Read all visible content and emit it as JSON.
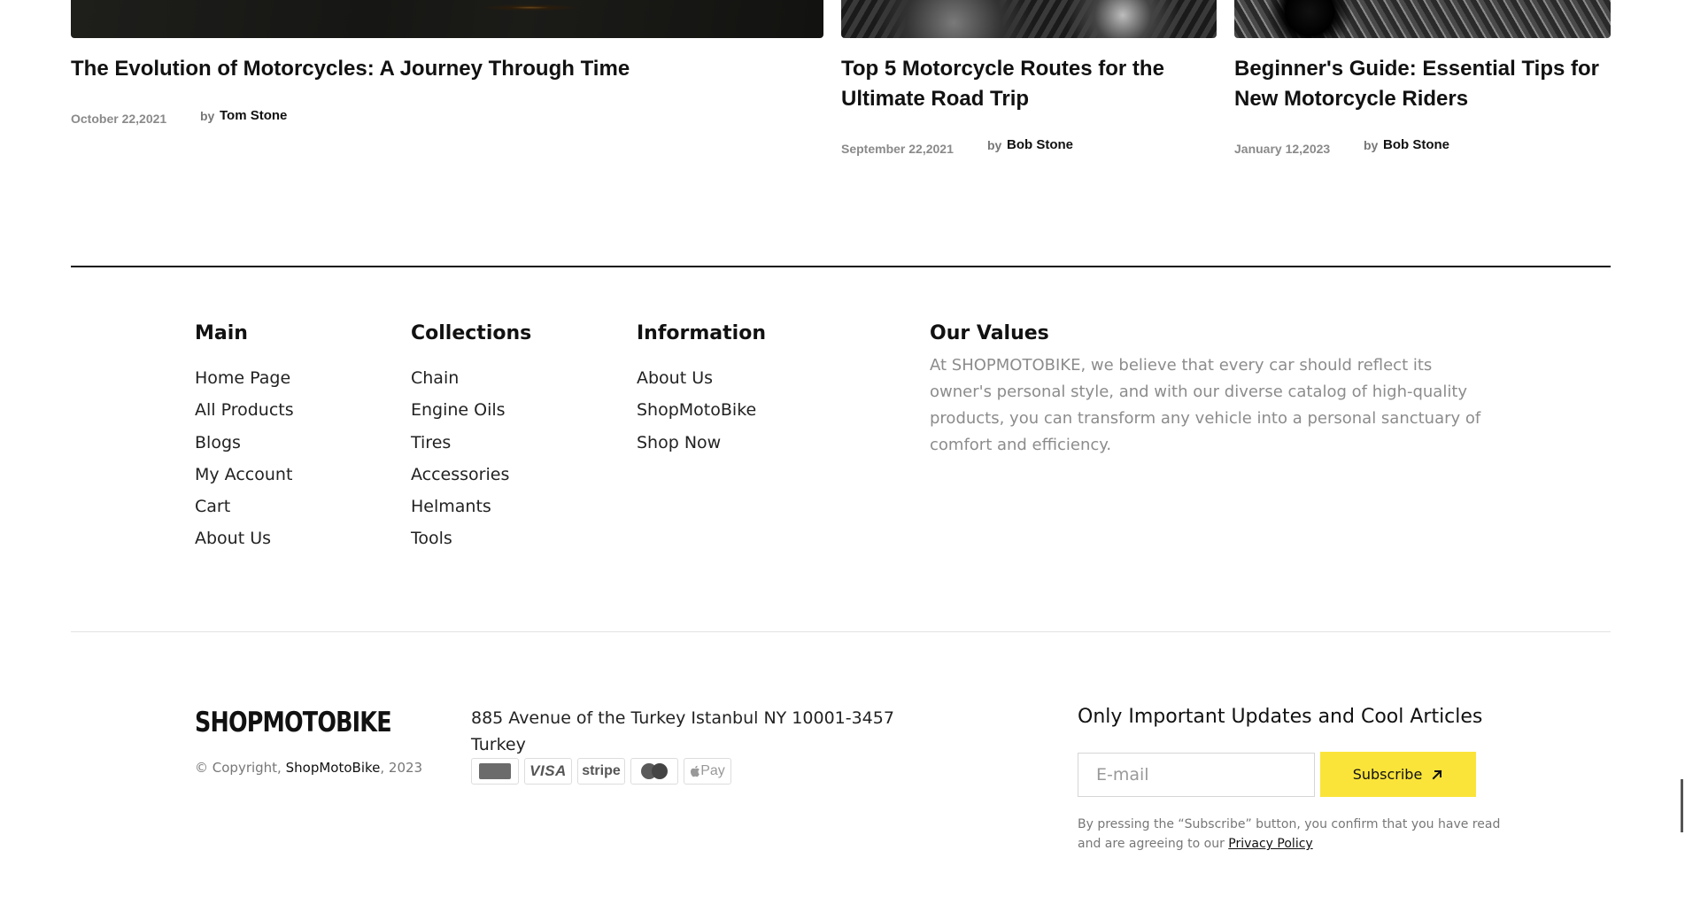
{
  "blog": {
    "posts": [
      {
        "title": "The Evolution of Motorcycles: A Journey Through Time",
        "date": "October 22,2021",
        "by": "by",
        "author": "Tom Stone"
      },
      {
        "title": "Top 5 Motorcycle Routes for the Ultimate Road Trip",
        "date": "September 22,2021",
        "by": "by",
        "author": "Bob Stone"
      },
      {
        "title": "Beginner's Guide: Essential Tips for New Motorcycle Riders",
        "date": "January 12,2023",
        "by": "by",
        "author": "Bob Stone"
      }
    ]
  },
  "footer": {
    "main": {
      "title": "Main",
      "links": [
        "Home Page",
        "All Products",
        "Blogs",
        "My Account",
        "Cart",
        "About Us"
      ]
    },
    "collections": {
      "title": "Collections",
      "links": [
        "Chain",
        "Engine Oils",
        "Tires",
        "Accessories",
        "Helmants",
        "Tools"
      ]
    },
    "information": {
      "title": "Information",
      "links": [
        "About Us",
        "ShopMotoBike",
        "Shop Now"
      ]
    },
    "values": {
      "title": "Our Values",
      "text": "At SHOPMOTOBIKE, we believe that every car should reflect its owner's personal style, and with our diverse catalog of high-quality products, you can transform any vehicle into a personal sanctuary of comfort and efficiency."
    }
  },
  "bottom": {
    "logo": "SHOPMOTOBIKE",
    "copyright_prefix": "© Copyright,",
    "copyright_brand": "ShopMotoBike",
    "copyright_year": ", 2023",
    "address": "885 Avenue of the Turkey Istanbul NY 10001-3457 Turkey",
    "payments": {
      "amex_icon": "american-express-icon",
      "visa": "VISA",
      "stripe": "stripe",
      "mastercard_icon": "mastercard-icon",
      "applepay": " Pay"
    },
    "newsletter": {
      "title": "Only Important Updates and Cool Articles",
      "email_placeholder": "E-mail",
      "email_value": "",
      "button_label": "Subscribe",
      "button_icon": "arrow-up-right-icon",
      "disclaimer": "By pressing the “Subscribe” button, you confirm that you have read and are agreeing to our",
      "privacy_link": "Privacy Policy"
    }
  },
  "colors": {
    "accent": "#fbe43a",
    "text_dark": "#111111",
    "text_muted": "#8c8c8c",
    "divider": "#111111"
  }
}
